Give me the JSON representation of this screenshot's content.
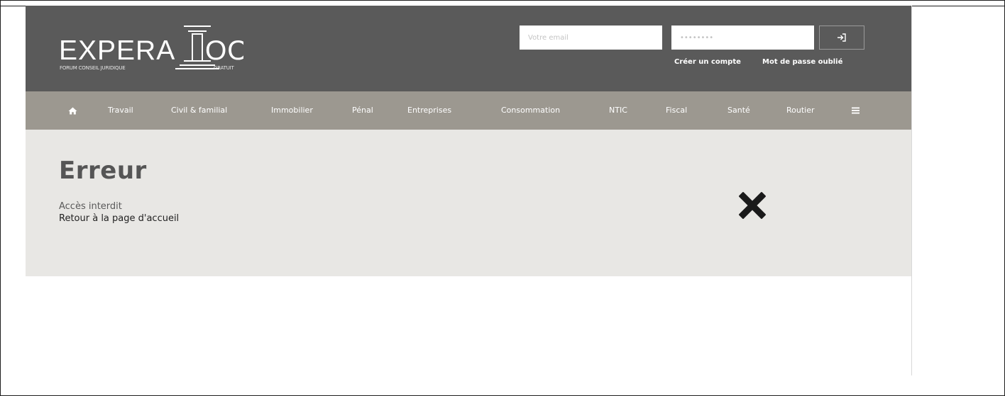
{
  "header": {
    "logo": {
      "wordmark_left": "EXPERA",
      "wordmark_right": "OO",
      "tagline_left": "FORUM CONSEIL JURIDIQUE",
      "tagline_right": "GRATUIT"
    },
    "login": {
      "email_placeholder": "Votre email",
      "password_placeholder": "••••••••",
      "login_button_icon": "sign-in-icon"
    },
    "links": {
      "create_account": "Créer un compte",
      "forgot_password": "Mot de passe oublié"
    },
    "background_color": "#5a5a5a"
  },
  "nav": {
    "home_icon": "home-icon",
    "items": [
      {
        "label": "Travail"
      },
      {
        "label": "Civil & familial"
      },
      {
        "label": "Immobilier"
      },
      {
        "label": "Pénal"
      },
      {
        "label": "Entreprises"
      },
      {
        "label": "Consommation"
      },
      {
        "label": "NTIC"
      },
      {
        "label": "Fiscal"
      },
      {
        "label": "Santé"
      },
      {
        "label": "Routier"
      }
    ],
    "menu_icon": "hamburger-menu-icon",
    "background_color": "#9c9890"
  },
  "error": {
    "title": "Erreur",
    "message": "Accès interdit",
    "home_link": "Retour à la page d'accueil",
    "icon": "close-x-icon",
    "background_color": "#e8e7e4"
  }
}
